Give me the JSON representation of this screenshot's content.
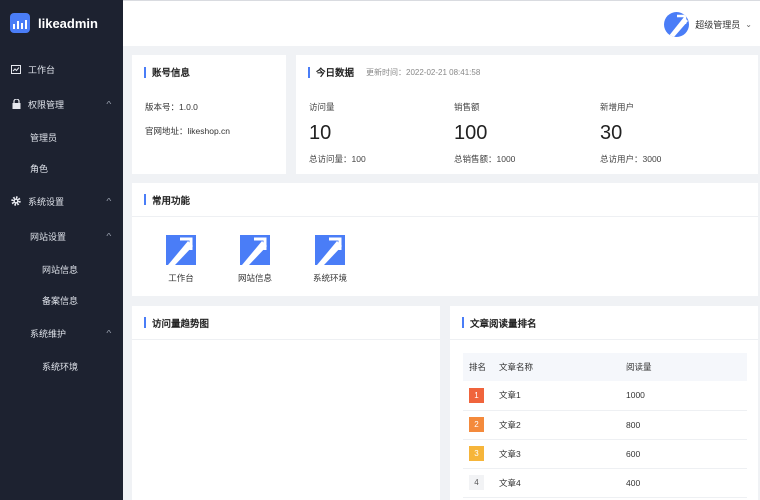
{
  "app": {
    "title": "likeadmin",
    "colors": {
      "sidebar": "#1d2230",
      "accent": "#4a7df7",
      "background": "#f0f2f5"
    }
  },
  "sidebar": {
    "items": [
      {
        "label": "工作台",
        "icon": "dashboard-icon",
        "level": 1
      },
      {
        "label": "权限管理",
        "icon": "lock-icon",
        "level": 1,
        "expanded": true
      },
      {
        "label": "管理员",
        "level": 2
      },
      {
        "label": "角色",
        "level": 2
      },
      {
        "label": "系统设置",
        "icon": "gear-icon",
        "level": 1,
        "expanded": true
      },
      {
        "label": "网站设置",
        "level": 2,
        "expanded": true
      },
      {
        "label": "网站信息",
        "level": 3
      },
      {
        "label": "备案信息",
        "level": 3
      },
      {
        "label": "系统维护",
        "level": 2,
        "expanded": true
      },
      {
        "label": "系统环境",
        "level": 3
      }
    ]
  },
  "header": {
    "user_name": "超级管理员"
  },
  "account": {
    "title": "账号信息",
    "version": "版本号：1.0.0",
    "website": "官网地址：likeshop.cn"
  },
  "today": {
    "title": "今日数据",
    "updated": "更新时间：2022-02-21 08:41:58",
    "stats": [
      {
        "label": "访问量",
        "value": "10",
        "total": "总访问量：100"
      },
      {
        "label": "销售额",
        "value": "100",
        "total": "总销售额：1000"
      },
      {
        "label": "新增用户",
        "value": "30",
        "total": "总访用户：3000"
      }
    ]
  },
  "functions": {
    "title": "常用功能",
    "items": [
      {
        "label": "工作台"
      },
      {
        "label": "网站信息"
      },
      {
        "label": "系统环境"
      }
    ]
  },
  "trend": {
    "title": "访问量趋势图"
  },
  "ranking": {
    "title": "文章阅读量排名",
    "columns": [
      "排名",
      "文章名称",
      "阅读量"
    ],
    "rows": [
      {
        "rank": "1",
        "name": "文章1",
        "reads": "1000",
        "color": "#f0643c"
      },
      {
        "rank": "2",
        "name": "文章2",
        "reads": "800",
        "color": "#f48a3c"
      },
      {
        "rank": "3",
        "name": "文章3",
        "reads": "600",
        "color": "#f6b53a"
      },
      {
        "rank": "4",
        "name": "文章4",
        "reads": "400",
        "color": "#f2f3f5"
      }
    ]
  }
}
